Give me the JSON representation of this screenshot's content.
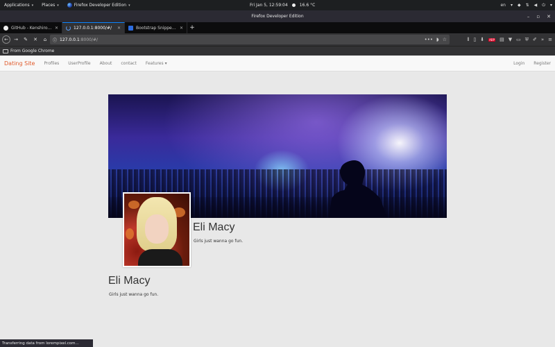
{
  "gnome": {
    "applications": "Applications",
    "places": "Places",
    "active_app": "Firefox Developer Edition",
    "clock": "Fri Jan  5, 12:59:04",
    "weather": "16.6 °C",
    "lang": "en"
  },
  "window": {
    "title": "Firefox Developer Edition"
  },
  "tabs": [
    {
      "label": "GitHub - Kenshirosan/lar..."
    },
    {
      "label": "127.0.0.1:8000/#/"
    },
    {
      "label": "Bootstrap Snippet FB-lik..."
    }
  ],
  "url": {
    "host": "127.0.0.1",
    "path": ":8000/#/"
  },
  "bookmarks": {
    "folder": "From Google Chrome"
  },
  "site": {
    "brand": "Dating Site",
    "links": [
      "Profiles",
      "UserProfile",
      "About",
      "contact",
      "Features"
    ],
    "login": "Login",
    "register": "Register"
  },
  "profile": {
    "name": "Eli Macy",
    "tagline": "Girls just wanna go fun."
  },
  "status": "Transferring data from lorempixel.com..."
}
